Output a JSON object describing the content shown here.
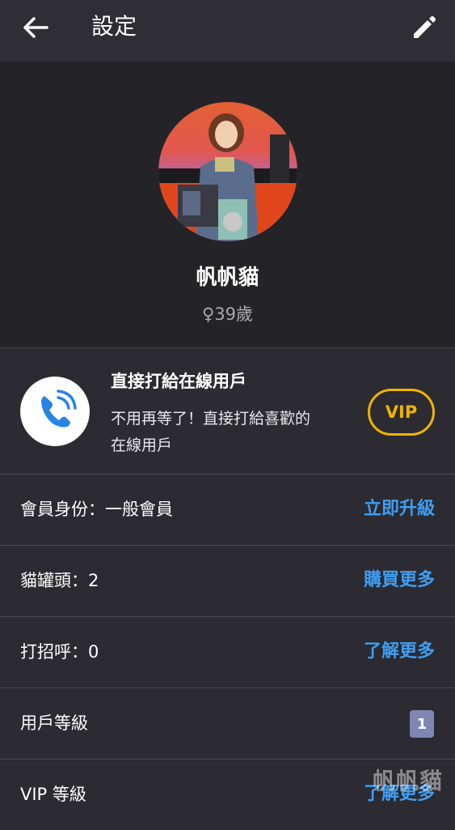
{
  "app_bar": {
    "title": "設定",
    "back_icon": "arrow-left-icon",
    "edit_icon": "pencil-icon"
  },
  "profile": {
    "name": "帆帆貓",
    "age": "♀39歲"
  },
  "promo": {
    "title": "直接打給在線用戶",
    "description_line1": "不用再等了！直接打給喜歡的",
    "description_line2": "在線用戶",
    "vip_button": "VIP",
    "icon": "phone-call-icon"
  },
  "rows": [
    {
      "label": "會員身份：一般會員",
      "action": "立即升級"
    },
    {
      "label": "貓罐頭：2",
      "action": "購買更多"
    },
    {
      "label": "打招呼：0",
      "action": "了解更多"
    },
    {
      "label": "用戶等級",
      "badge": "1"
    },
    {
      "label": "VIP 等級",
      "action": "了解更多"
    }
  ],
  "watermark": "帆帆貓",
  "colors": {
    "accent_blue": "#3f9ef2",
    "vip_gold": "#f1b300",
    "background": "#2b2b31",
    "profile_background": "#242428",
    "badge": "#7f86b4"
  }
}
